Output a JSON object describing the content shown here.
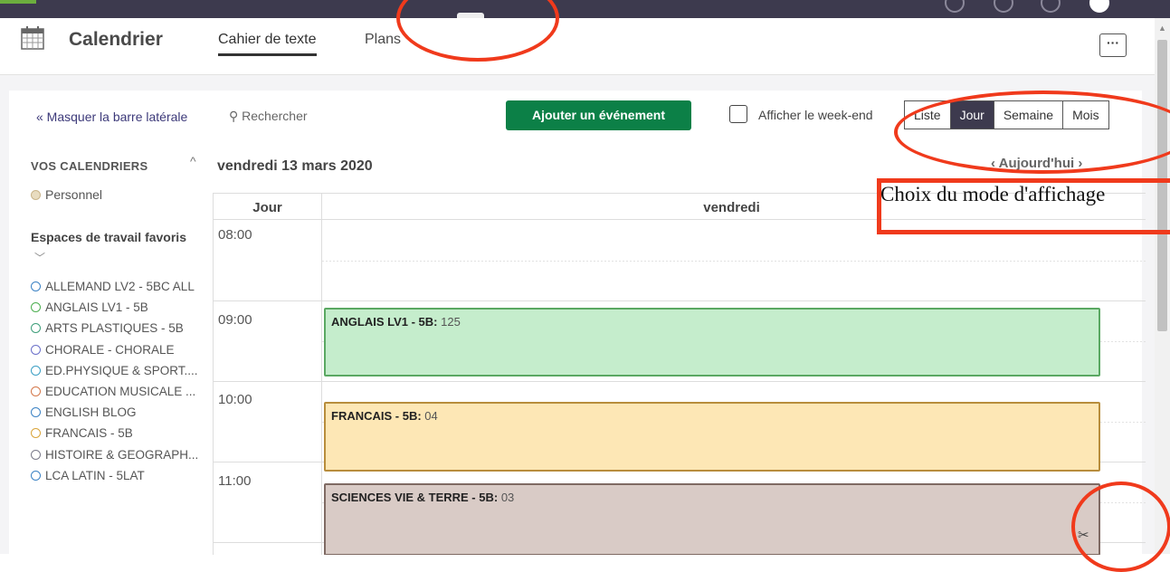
{
  "header": {
    "app_title": "Calendrier",
    "tabs": [
      {
        "label": "Cahier de texte",
        "active": true
      },
      {
        "label": "Plans",
        "active": false
      }
    ],
    "more_label": "···"
  },
  "toolbar": {
    "hide_sidebar": "« Masquer la barre latérale",
    "search_placeholder": "Rechercher",
    "add_event": "Ajouter un événement",
    "show_weekend": "Afficher le week-end",
    "views": [
      {
        "label": "Liste",
        "active": false
      },
      {
        "label": "Jour",
        "active": true
      },
      {
        "label": "Semaine",
        "active": false
      },
      {
        "label": "Mois",
        "active": false
      }
    ]
  },
  "sidebar": {
    "my_calendars_heading": "VOS CALENDRIERS",
    "personal": "Personnel",
    "favorites_heading": "Espaces de travail favoris",
    "favorites": [
      {
        "label": "ALLEMAND LV2 - 5BC ALL",
        "color": "#3b82c4"
      },
      {
        "label": "ANGLAIS LV1 - 5B",
        "color": "#4caf50"
      },
      {
        "label": "ARTS PLASTIQUES - 5B",
        "color": "#3e9e7a"
      },
      {
        "label": "CHORALE - CHORALE",
        "color": "#6a6fc9"
      },
      {
        "label": "ED.PHYSIQUE & SPORT....",
        "color": "#3b9fc4"
      },
      {
        "label": "EDUCATION MUSICALE ...",
        "color": "#d4784a"
      },
      {
        "label": "ENGLISH BLOG",
        "color": "#3b82c4"
      },
      {
        "label": "FRANCAIS - 5B",
        "color": "#d9a43a"
      },
      {
        "label": "HISTOIRE & GEOGRAPH...",
        "color": "#7a7a8a"
      },
      {
        "label": "LCA LATIN - 5LAT",
        "color": "#3b82c4"
      }
    ]
  },
  "calendar": {
    "date_title": "vendredi 13 mars 2020",
    "today_nav": "‹ Aujourd'hui ›",
    "time_col_header": "Jour",
    "day_col_header": "vendredi",
    "hours": [
      "08:00",
      "09:00",
      "10:00",
      "11:00"
    ],
    "events": [
      {
        "title": "ANGLAIS LV1 - 5B:",
        "location": "125",
        "bg": "#c5edcc",
        "border": "#5aa862"
      },
      {
        "title": "FRANCAIS - 5B:",
        "location": "04",
        "bg": "#fde7b5",
        "border": "#b88d3c"
      },
      {
        "title": "SCIENCES VIE & TERRE - 5B:",
        "location": "03",
        "bg": "#d9cbc6",
        "border": "#7f6a63"
      }
    ]
  },
  "annotation": {
    "text": "Choix du mode d'affichage"
  }
}
